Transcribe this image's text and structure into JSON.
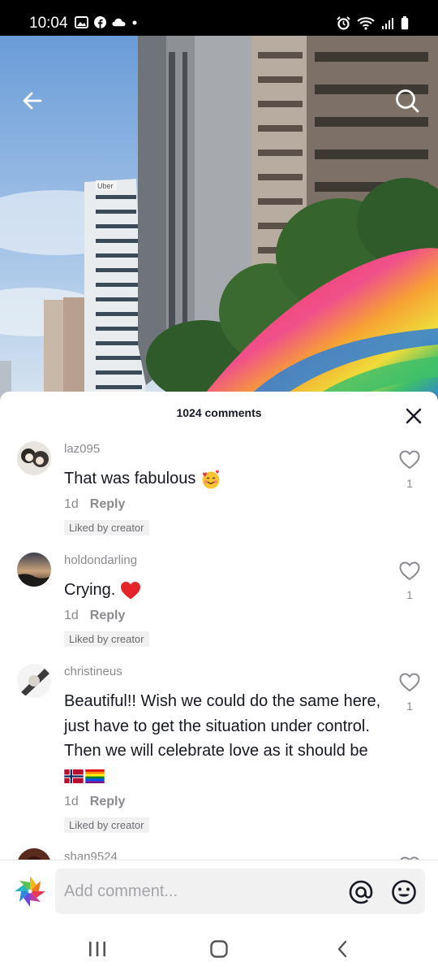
{
  "status_bar": {
    "time": "10:04"
  },
  "video": {
    "building_sign": "Uber"
  },
  "sheet": {
    "comment_count": "1024 comments"
  },
  "comments": [
    {
      "username": "laz095",
      "text": "That was fabulous",
      "emoji": "smiling-hearts",
      "age": "1d",
      "reply_label": "Reply",
      "badge": "Liked by creator",
      "likes": "1"
    },
    {
      "username": "holdondarling",
      "text": "Crying.",
      "emoji": "red-heart",
      "age": "1d",
      "reply_label": "Reply",
      "badge": "Liked by creator",
      "likes": "1"
    },
    {
      "username": "christineus",
      "text": "Beautiful!! Wish we could do the same here, just have to get the situation under control. Then we will celebrate love as it should be",
      "emoji": "norway-flag rainbow-flag",
      "age": "1d",
      "reply_label": "Reply",
      "badge": "Liked by creator",
      "likes": "1"
    },
    {
      "username": "shan9524"
    }
  ],
  "input": {
    "placeholder": "Add comment..."
  },
  "colors": {
    "text_primary": "#161823",
    "text_secondary": "#8a8b91",
    "input_bg": "#f1f1f2"
  }
}
